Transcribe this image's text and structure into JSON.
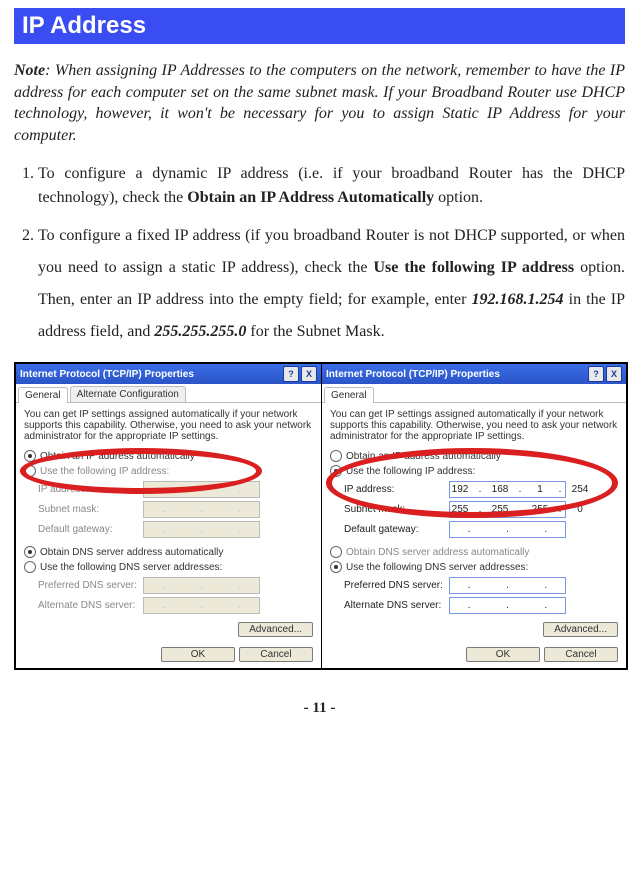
{
  "header": {
    "title": "IP Address"
  },
  "note": {
    "label": "Note",
    "body": ": When assigning IP Addresses to the computers on the network, remember to have the IP address for each computer set on the same subnet mask. If your Broadband Router use DHCP technology, however, it won't be necessary for you to assign Static IP Address for your computer."
  },
  "list": {
    "item1": {
      "pre": "To configure a dynamic IP address (i.e. if your broadband Router has the DHCP technology), check the ",
      "bold": "Obtain an IP Address Automatically",
      "post": " option."
    },
    "item2": {
      "a": "To configure a fixed IP address (if you broadband Router is not DHCP supported, or when you need to assign a static IP address), check the ",
      "b": "Use the following IP address",
      "c": " option. Then, enter an IP address into the empty field; for example, enter ",
      "ip": "192.168.1.254",
      "d": " in the IP address field, and ",
      "mask": "255.255.255.0",
      "e": " for the Subnet Mask."
    }
  },
  "dialog": {
    "title": "Internet Protocol (TCP/IP) Properties",
    "tabs": {
      "general": "General",
      "alt": "Alternate Configuration"
    },
    "blurb": "You can get IP settings assigned automatically if your network supports this capability. Otherwise, you need to ask your network administrator for the appropriate IP settings.",
    "opt_auto_ip": "Obtain an IP address automatically",
    "opt_use_ip": "Use the following IP address:",
    "lbl_ip": "IP address:",
    "lbl_mask": "Subnet mask:",
    "lbl_gw": "Default gateway:",
    "opt_auto_dns": "Obtain DNS server address automatically",
    "opt_use_dns": "Use the following DNS server addresses:",
    "lbl_pref": "Preferred DNS server:",
    "lbl_alt": "Alternate DNS server:",
    "btn_adv": "Advanced...",
    "btn_ok": "OK",
    "btn_cancel": "Cancel",
    "help": "?",
    "close": "X",
    "ip_val": {
      "a": "192",
      "b": "168",
      "c": "1",
      "d": "254"
    },
    "mask_val": {
      "a": "255",
      "b": "255",
      "c": "255",
      "d": "0"
    },
    "dot": "."
  },
  "footer": {
    "page": "- 11 -"
  }
}
